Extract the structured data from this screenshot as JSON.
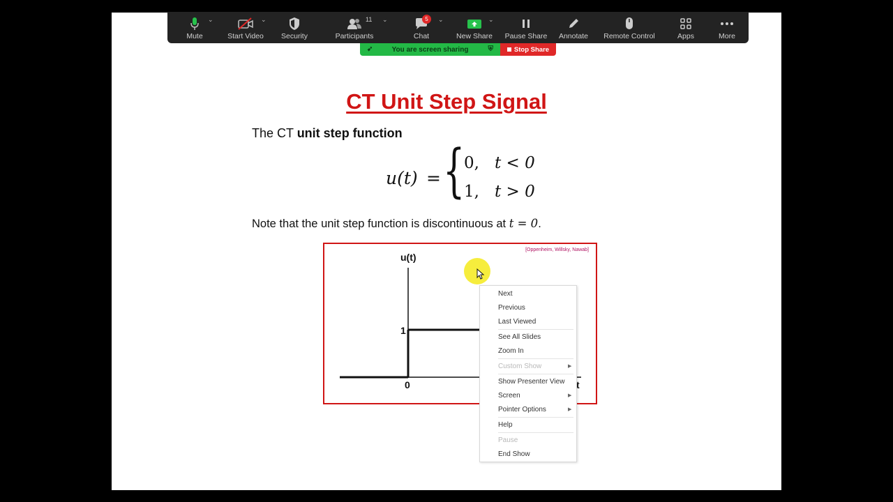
{
  "toolbar": {
    "mute": "Mute",
    "start_video": "Start Video",
    "security": "Security",
    "participants": "Participants",
    "participants_count": "11",
    "chat": "Chat",
    "chat_badge": "5",
    "new_share": "New Share",
    "pause_share": "Pause Share",
    "annotate": "Annotate",
    "remote_control": "Remote Control",
    "apps": "Apps",
    "more": "More"
  },
  "sharing": {
    "status": "You are screen sharing",
    "stop": "Stop Share"
  },
  "slide": {
    "title": "CT Unit Step Signal",
    "intro_prefix": "The CT ",
    "intro_bold": "unit step function",
    "eq_lhs": "u(t)",
    "eq_sign": "=",
    "eq_row1_val": "0,",
    "eq_row1_cond": "t < 0",
    "eq_row2_val": "1,",
    "eq_row2_cond": "t > 0",
    "note_prefix": "Note that the unit step function is discontinuous at ",
    "note_math": "t = 0",
    "note_suffix": ".",
    "figure": {
      "citation": "[Oppenheim, Willsky, Nawab]",
      "ylabel": "u(t)",
      "level_label": "1",
      "origin_label": "0",
      "xlabel": "t"
    }
  },
  "context_menu": {
    "items": [
      {
        "label": "Next"
      },
      {
        "label": "Previous"
      },
      {
        "label": "Last Viewed"
      },
      {
        "label": "See All Slides"
      },
      {
        "label": "Zoom In"
      },
      {
        "label": "Custom Show"
      },
      {
        "label": "Show Presenter View"
      },
      {
        "label": "Screen"
      },
      {
        "label": "Pointer Options"
      },
      {
        "label": "Help"
      },
      {
        "label": "Pause"
      },
      {
        "label": "End Show"
      }
    ]
  },
  "colors": {
    "title_red": "#d01515",
    "share_green": "#23b946",
    "stop_red": "#e02828",
    "toolbar_bg": "#232323",
    "pointer_yellow": "#f5eb28"
  }
}
